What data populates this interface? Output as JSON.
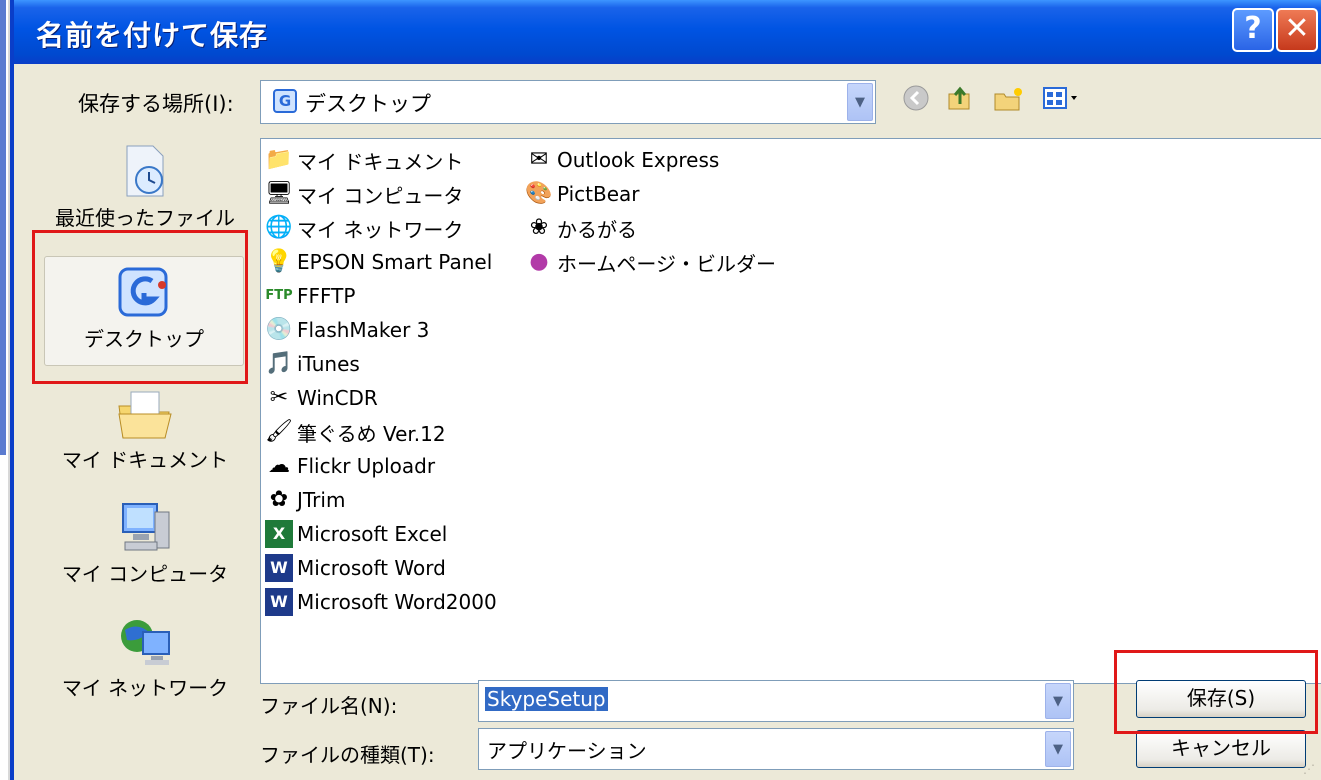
{
  "window": {
    "title": "名前を付けて保存"
  },
  "titlebar_buttons": {
    "help": "?",
    "close": "✕"
  },
  "save_in": {
    "label": "保存する場所(I):",
    "value": "デスクトップ"
  },
  "toolbar": {
    "icons": [
      "back-icon",
      "up-folder-icon",
      "new-folder-icon",
      "view-menu-icon"
    ]
  },
  "places": [
    {
      "label": "最近使ったファイル",
      "icon": "recent-files-icon"
    },
    {
      "label": "デスクトップ",
      "icon": "desktop-icon",
      "selected": true
    },
    {
      "label": "マイ ドキュメント",
      "icon": "my-documents-icon"
    },
    {
      "label": "マイ コンピュータ",
      "icon": "my-computer-icon"
    },
    {
      "label": "マイ ネットワーク",
      "icon": "my-network-icon"
    }
  ],
  "files": [
    {
      "name": "マイ ドキュメント",
      "icon": "documents-icon"
    },
    {
      "name": "マイ コンピュータ",
      "icon": "computer-icon"
    },
    {
      "name": "マイ ネットワーク",
      "icon": "network-icon"
    },
    {
      "name": "EPSON Smart Panel",
      "icon": "epson-icon"
    },
    {
      "name": "FFFTP",
      "icon": "ftp-icon"
    },
    {
      "name": "FlashMaker 3",
      "icon": "flashmaker-icon"
    },
    {
      "name": "iTunes",
      "icon": "itunes-icon"
    },
    {
      "name": "WinCDR",
      "icon": "wincdr-icon"
    },
    {
      "name": "筆ぐるめ Ver.12",
      "icon": "fudegurume-icon"
    },
    {
      "name": "Flickr Uploadr",
      "icon": "flickr-icon"
    },
    {
      "name": "JTrim",
      "icon": "jtrim-icon"
    },
    {
      "name": "Microsoft Excel",
      "icon": "excel-icon"
    },
    {
      "name": "Microsoft Word",
      "icon": "word-icon"
    },
    {
      "name": "Microsoft Word2000",
      "icon": "word-icon"
    },
    {
      "name": "Outlook Express",
      "icon": "outlook-icon"
    },
    {
      "name": "PictBear",
      "icon": "pictbear-icon"
    },
    {
      "name": "かるがる",
      "icon": "karugaru-icon"
    },
    {
      "name": "ホームページ・ビルダー",
      "icon": "homepage-builder-icon"
    }
  ],
  "filename": {
    "label": "ファイル名(N):",
    "value": "SkypeSetup"
  },
  "filetype": {
    "label": "ファイルの種類(T):",
    "value": "アプリケーション"
  },
  "buttons": {
    "save": "保存(S)",
    "cancel": "キャンセル"
  }
}
